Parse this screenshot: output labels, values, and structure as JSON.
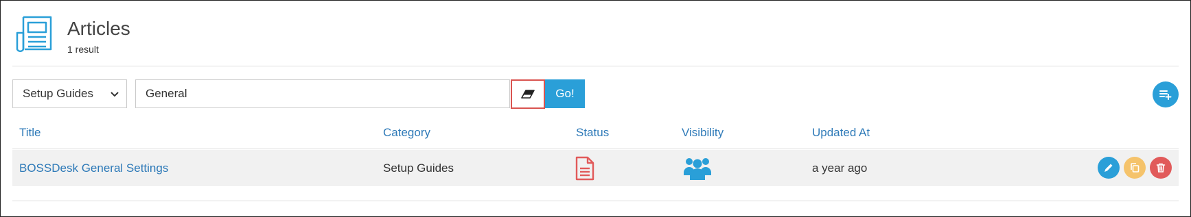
{
  "header": {
    "title": "Articles",
    "result_count": "1 result"
  },
  "toolbar": {
    "category_select": {
      "selected": "Setup Guides"
    },
    "search": {
      "value": "General"
    },
    "go_label": "Go!"
  },
  "table": {
    "columns": [
      "Title",
      "Category",
      "Status",
      "Visibility",
      "Updated At"
    ],
    "rows": [
      {
        "title": "BOSSDesk General Settings",
        "category": "Setup Guides",
        "status_icon": "document-icon",
        "visibility_icon": "users-icon",
        "updated_at": "a year ago"
      }
    ]
  },
  "colors": {
    "accent": "#2a9fd8",
    "link": "#2e7ab8",
    "danger": "#e15a5a",
    "warning": "#f5c36b"
  }
}
